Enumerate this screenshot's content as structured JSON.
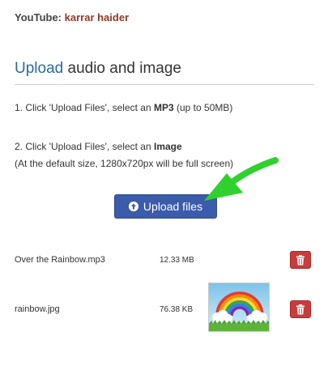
{
  "credit": {
    "prefix": "YouTube:",
    "author": "karrar haider"
  },
  "heading": {
    "accent": "Upload",
    "rest": " audio and image"
  },
  "steps": [
    {
      "pre": "1. Click 'Upload Files', select an ",
      "bold": "MP3",
      "post": " (up to 50MB)"
    },
    {
      "pre": "2. Click 'Upload Files', select an ",
      "bold": "Image",
      "post": ""
    }
  ],
  "note": "(At the default size, 1280x720px will be full screen)",
  "upload_button": {
    "label": "Upload files",
    "icon": "arrow-up-circle-icon"
  },
  "files": [
    {
      "name": "Over the Rainbow.mp3",
      "size": "12.33 MB",
      "delete_icon": "trash-icon"
    },
    {
      "name": "rainbow.jpg",
      "size": "76.38 KB",
      "delete_icon": "trash-icon",
      "thumbnail": "rainbow-image"
    }
  ],
  "colors": {
    "accent": "#2a6a9e",
    "button": "#3b5bab",
    "delete": "#cc3b3b",
    "arrow": "#2fd12f"
  }
}
